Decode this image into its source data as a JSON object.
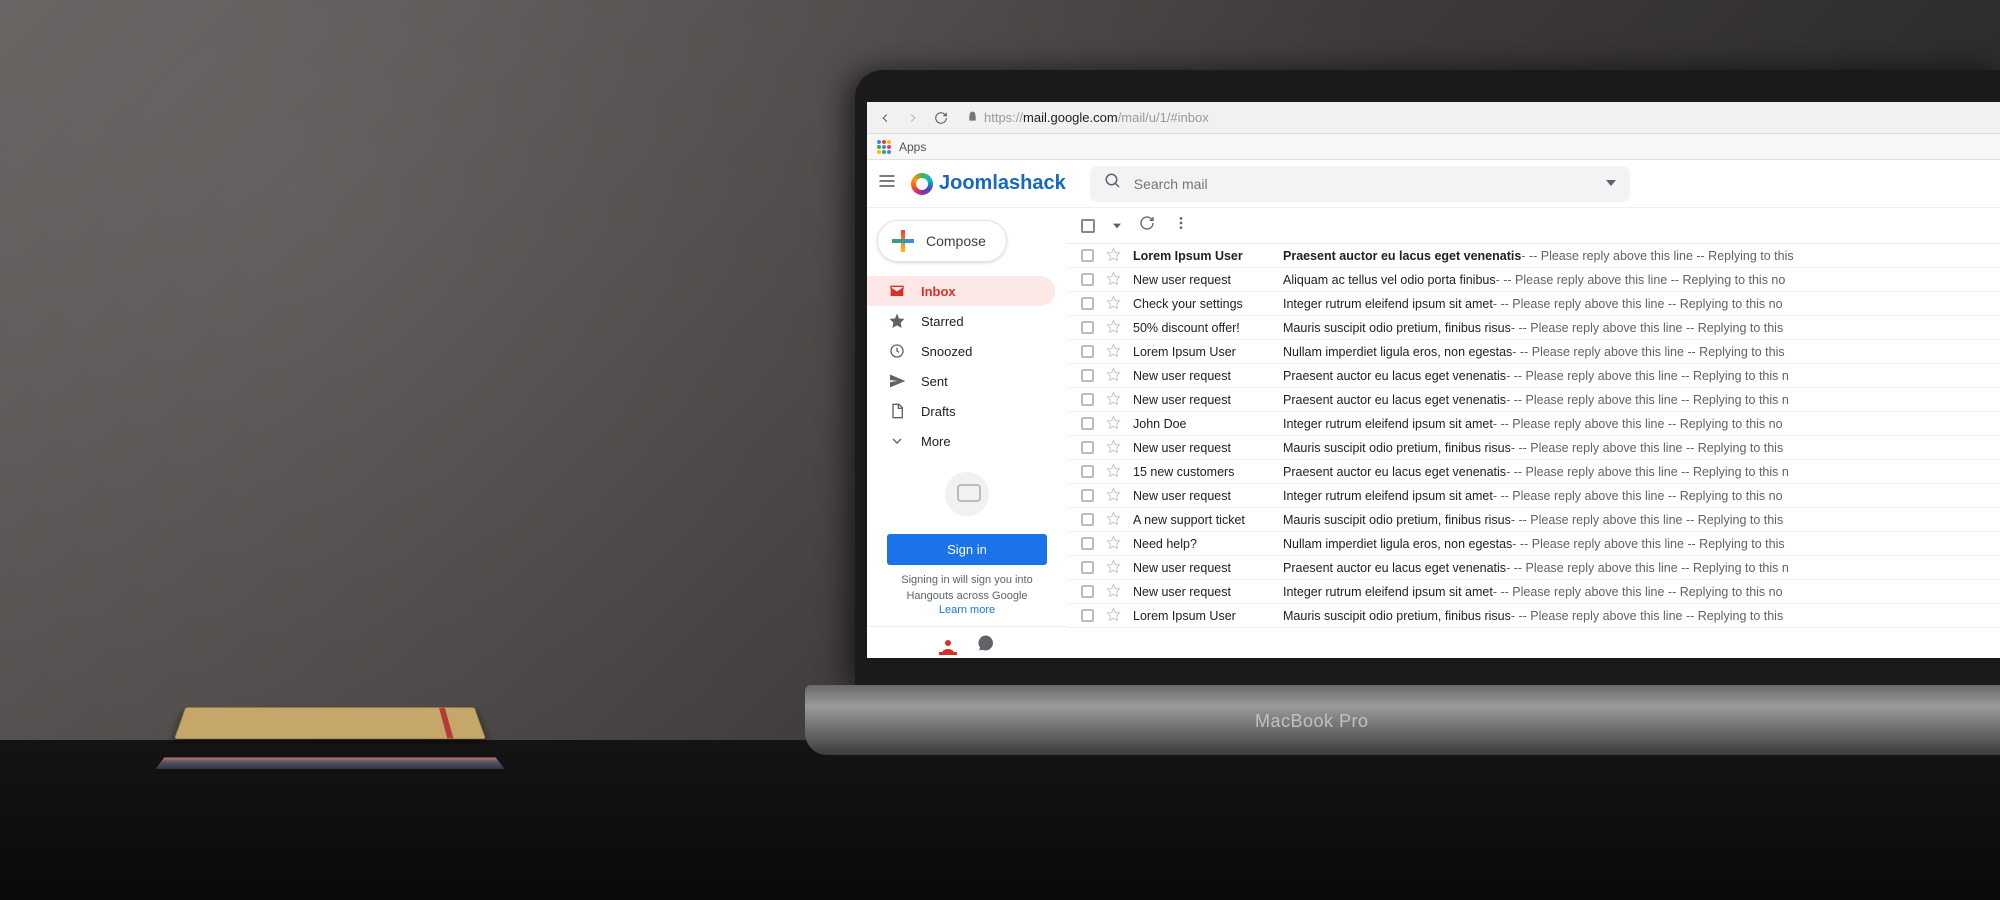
{
  "browser": {
    "apps_label": "Apps",
    "url_prefix": "https://",
    "url_host": "mail.google.com",
    "url_path": "/mail/u/1/#inbox"
  },
  "header": {
    "brand": "Joomlashack",
    "search_placeholder": "Search mail"
  },
  "sidebar": {
    "compose": "Compose",
    "items": [
      {
        "label": "Inbox",
        "key": "inbox",
        "active": true
      },
      {
        "label": "Starred",
        "key": "starred"
      },
      {
        "label": "Snoozed",
        "key": "snoozed"
      },
      {
        "label": "Sent",
        "key": "sent"
      },
      {
        "label": "Drafts",
        "key": "drafts"
      },
      {
        "label": "More",
        "key": "more"
      }
    ],
    "signin_button": "Sign in",
    "signin_text": "Signing in will sign you into Hangouts across Google",
    "learn_more": "Learn more"
  },
  "messages": [
    {
      "sender": "Lorem Ipsum User",
      "subject": "Praesent auctor eu lacus eget venenatis",
      "snippet": " - -- Please reply above this line -- Replying to this",
      "unread": true
    },
    {
      "sender": "New user request",
      "subject": "Aliquam ac tellus vel odio porta finibus",
      "snippet": " - -- Please reply above this line -- Replying to this no"
    },
    {
      "sender": "Check your settings",
      "subject": "Integer rutrum eleifend ipsum sit amet",
      "snippet": " - -- Please reply above this line -- Replying to this no"
    },
    {
      "sender": "50% discount offer!",
      "subject": "Mauris suscipit odio pretium, finibus risus",
      "snippet": " - -- Please reply above this line -- Replying to this"
    },
    {
      "sender": "Lorem Ipsum User",
      "subject": "Nullam imperdiet ligula eros, non egestas",
      "snippet": " - -- Please reply above this line -- Replying to this"
    },
    {
      "sender": "New user request",
      "subject": "Praesent auctor eu lacus eget venenatis",
      "snippet": " - -- Please reply above this line -- Replying to this n"
    },
    {
      "sender": "New user request",
      "subject": "Praesent auctor eu lacus eget venenatis",
      "snippet": " - -- Please reply above this line -- Replying to this n"
    },
    {
      "sender": "John Doe",
      "subject": "Integer rutrum eleifend ipsum sit amet",
      "snippet": " - -- Please reply above this line -- Replying to this no"
    },
    {
      "sender": "New user request",
      "subject": "Mauris suscipit odio pretium, finibus risus",
      "snippet": " - -- Please reply above this line -- Replying to this"
    },
    {
      "sender": "15 new customers",
      "subject": "Praesent auctor eu lacus eget venenatis",
      "snippet": " - -- Please reply above this line -- Replying to this n"
    },
    {
      "sender": "New user request",
      "subject": "Integer rutrum eleifend ipsum sit amet",
      "snippet": " - -- Please reply above this line -- Replying to this no"
    },
    {
      "sender": "A new support ticket",
      "subject": "Mauris suscipit odio pretium, finibus risus",
      "snippet": " - -- Please reply above this line -- Replying to this"
    },
    {
      "sender": "Need help?",
      "subject": "Nullam imperdiet ligula eros, non egestas",
      "snippet": " - -- Please reply above this line -- Replying to this"
    },
    {
      "sender": "New user request",
      "subject": "Praesent auctor eu lacus eget venenatis",
      "snippet": " - -- Please reply above this line -- Replying to this n"
    },
    {
      "sender": "New user request",
      "subject": "Integer rutrum eleifend ipsum sit amet",
      "snippet": " - -- Please reply above this line -- Replying to this no"
    },
    {
      "sender": "Lorem Ipsum User",
      "subject": "Mauris suscipit odio pretium, finibus risus",
      "snippet": " - -- Please reply above this line -- Replying to this"
    }
  ],
  "laptop_model": "MacBook Pro"
}
